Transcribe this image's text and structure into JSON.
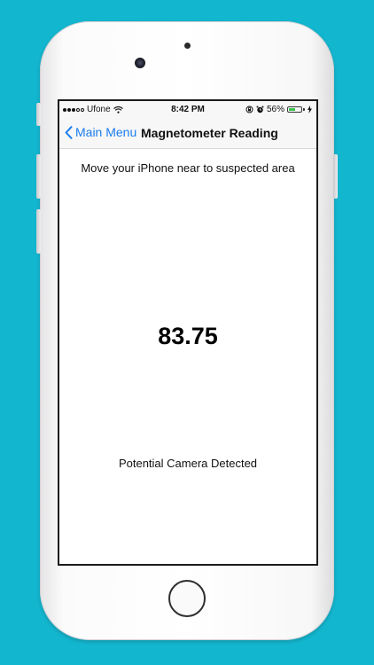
{
  "status_bar": {
    "carrier": "Ufone",
    "time": "8:42 PM",
    "battery_percent": "56%",
    "battery_level": 0.56,
    "battery_color": "#37c44c",
    "icons": [
      "wifi-icon",
      "rotation-lock-icon",
      "alarm-icon",
      "battery-icon",
      "charging-bolt-icon"
    ]
  },
  "nav": {
    "back_label": "Main Menu",
    "title": "Magnetometer Reading",
    "accent_color": "#1a7cf0"
  },
  "main": {
    "instruction": "Move your iPhone near to suspected area",
    "reading": "83.75",
    "status_message": "Potential Camera Detected"
  },
  "background_color": "#13b6cf"
}
